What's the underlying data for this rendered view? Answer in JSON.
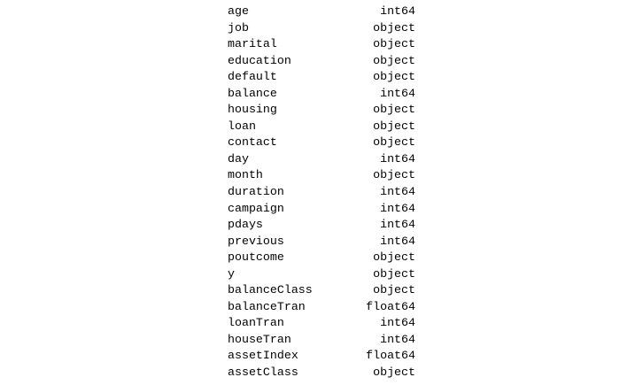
{
  "dtypes": [
    {
      "name": "age",
      "type": "int64"
    },
    {
      "name": "job",
      "type": "object"
    },
    {
      "name": "marital",
      "type": "object"
    },
    {
      "name": "education",
      "type": "object"
    },
    {
      "name": "default",
      "type": "object"
    },
    {
      "name": "balance",
      "type": "int64"
    },
    {
      "name": "housing",
      "type": "object"
    },
    {
      "name": "loan",
      "type": "object"
    },
    {
      "name": "contact",
      "type": "object"
    },
    {
      "name": "day",
      "type": "int64"
    },
    {
      "name": "month",
      "type": "object"
    },
    {
      "name": "duration",
      "type": "int64"
    },
    {
      "name": "campaign",
      "type": "int64"
    },
    {
      "name": "pdays",
      "type": "int64"
    },
    {
      "name": "previous",
      "type": "int64"
    },
    {
      "name": "poutcome",
      "type": "object"
    },
    {
      "name": "y",
      "type": "object"
    },
    {
      "name": "balanceClass",
      "type": "object"
    },
    {
      "name": "balanceTran",
      "type": "float64"
    },
    {
      "name": "loanTran",
      "type": "int64"
    },
    {
      "name": "houseTran",
      "type": "int64"
    },
    {
      "name": "assetIndex",
      "type": "float64"
    },
    {
      "name": "assetClass",
      "type": "object"
    }
  ]
}
